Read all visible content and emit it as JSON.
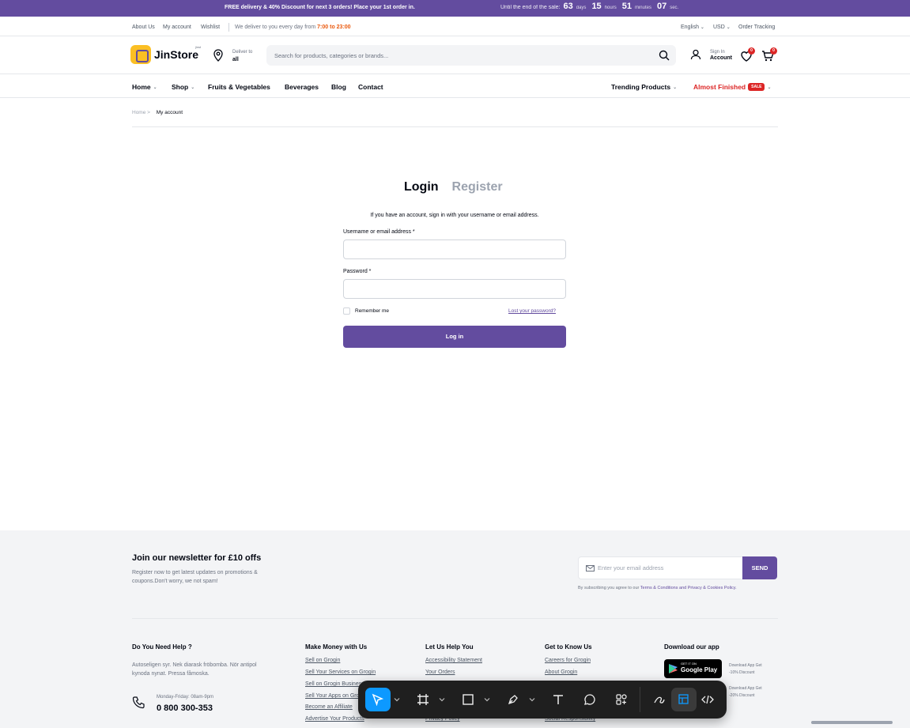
{
  "promo": {
    "message": "FREE delivery & 40% Discount for next 3 orders! Place your 1st order in.",
    "countdown_label": "Until the end of the sale:",
    "days": "63",
    "days_unit": "days",
    "hours": "15",
    "hours_unit": "hours",
    "minutes": "51",
    "minutes_unit": "minutes",
    "seconds": "07",
    "seconds_unit": "sec."
  },
  "util": {
    "about": "About Us",
    "account": "My account",
    "wishlist": "Wishlist",
    "deliver_text": "We deliver to you every day from",
    "deliver_hours": "7:00 to 23:00",
    "language": "English",
    "currency": "USD",
    "tracking": "Order Tracking"
  },
  "header": {
    "logo": "JinStore",
    "logo_tag": "jinst",
    "deliver_label": "Deliver to",
    "deliver_value": "all",
    "search_placeholder": "Search for products, categories or brands...",
    "signin_label": "Sign In",
    "account_label": "Account",
    "wishlist_count": "0",
    "cart_count": "0"
  },
  "nav": {
    "home": "Home",
    "shop": "Shop",
    "fruits": "Fruits & Vegetables",
    "beverages": "Beverages",
    "blog": "Blog",
    "contact": "Contact",
    "trending": "Trending Products",
    "almost": "Almost Finished",
    "sale": "SALE"
  },
  "breadcrumb": {
    "home": "Home",
    "separator": ">",
    "current": "My account"
  },
  "login": {
    "tab_login": "Login",
    "tab_register": "Register",
    "intro": "If you have an account, sign in with your username or email address.",
    "username_label": "Username or email address *",
    "password_label": "Password *",
    "remember": "Remember me",
    "lost": "Lost your password?",
    "button": "Log in"
  },
  "newsletter": {
    "title": "Join our newsletter for £10 offs",
    "desc": "Register now to get latest updates on promotions & coupons.Don't worry, we not spam!",
    "placeholder": "Enter your email address",
    "send": "SEND",
    "terms_prefix": "By subscribing you agree to our",
    "terms_link": "Terms & Conditions and Privacy & Cookies Policy."
  },
  "footer": {
    "help_title": "Do You Need Help ?",
    "help_desc": "Autoseligen syr. Nek diarask fröbomba. Nör antipol kynoda nynat. Pressa fåmoska.",
    "hours": "Monday-Friday: 08am-9pm",
    "phone": "0 800 300-353",
    "col1_title": "Make Money with Us",
    "col1_links": [
      "Sell on Grogin",
      "Sell Your Services on Grogin",
      "Sell on Grogin Business",
      "Sell Your Apps on Grogin",
      "Become an Affiliate",
      "Advertise Your Products"
    ],
    "col2_title": "Let Us Help You",
    "col2_links": [
      "Accessibility Statement",
      "Your Orders",
      "Privacy Policy"
    ],
    "col3_title": "Get to Know Us",
    "col3_links": [
      "Careers for Grogin",
      "About Grogin",
      "Social Responsibility"
    ],
    "col4_title": "Download our app",
    "store_small": "GET IT ON",
    "store_name": "Google Play",
    "store1_note_a": "Download App Get",
    "store1_note_b": "-10% Discount",
    "store2_note_a": "Download App Get",
    "store2_note_b": "-20% Discount"
  },
  "colors": {
    "brand": "#634c9f",
    "sale": "#dc2626",
    "accent_orange": "#ea580c",
    "tool_selected": "#0d99ff"
  },
  "toolbar": {
    "tools": [
      "move-tool-icon",
      "frame-tool-icon",
      "shape-tool-icon",
      "pen-tool-icon",
      "text-tool-icon",
      "comment-tool-icon",
      "actions-icon",
      "draw-icon",
      "dev-mode-icon",
      "code-icon"
    ]
  }
}
